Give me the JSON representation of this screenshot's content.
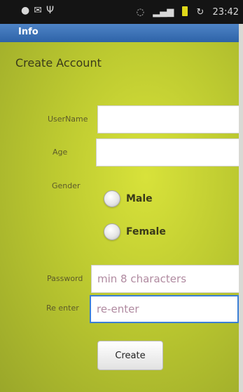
{
  "status_bar": {
    "left_icons": [
      "android-icon",
      "mail-icon",
      "usb-icon"
    ],
    "right_icons": [
      "alarm-icon",
      "signal-icon",
      "battery-icon",
      "sync-icon"
    ],
    "time": "23:42"
  },
  "title_bar": {
    "title": "Info"
  },
  "form": {
    "heading": "Create Account",
    "username_label": "UserName",
    "username_value": "",
    "age_label": "Age",
    "age_value": "",
    "gender_label": "Gender",
    "gender_options": [
      "Male",
      "Female"
    ],
    "password_label": "Password",
    "password_placeholder": "min 8 characters",
    "reenter_label": "Re enter",
    "reenter_placeholder": "re-enter",
    "create_button": "Create"
  }
}
